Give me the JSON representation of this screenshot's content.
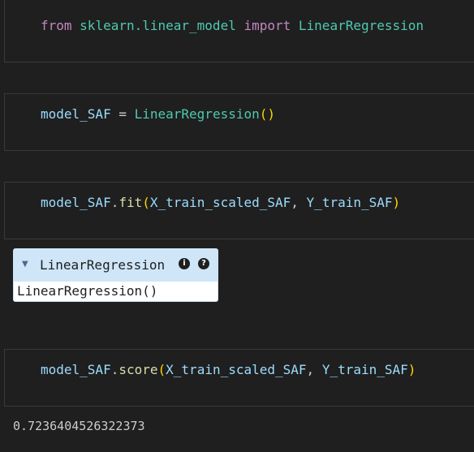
{
  "cells": [
    {
      "tokens": [
        {
          "text": "from",
          "kind": "kw"
        },
        {
          "text": " ",
          "kind": "punc"
        },
        {
          "text": "sklearn.linear_model",
          "kind": "mod"
        },
        {
          "text": " ",
          "kind": "punc"
        },
        {
          "text": "import",
          "kind": "kw"
        },
        {
          "text": " ",
          "kind": "punc"
        },
        {
          "text": "LinearRegression",
          "kind": "cls"
        }
      ]
    },
    {
      "tokens": [
        {
          "text": "model_SAF",
          "kind": "var"
        },
        {
          "text": " = ",
          "kind": "punc"
        },
        {
          "text": "LinearRegression",
          "kind": "cls"
        },
        {
          "text": "()",
          "kind": "paren"
        }
      ]
    },
    {
      "tokens": [
        {
          "text": "model_SAF",
          "kind": "var"
        },
        {
          "text": ".",
          "kind": "punc"
        },
        {
          "text": "fit",
          "kind": "fn"
        },
        {
          "text": "(",
          "kind": "paren"
        },
        {
          "text": "X_train_scaled_SAF",
          "kind": "var"
        },
        {
          "text": ", ",
          "kind": "punc"
        },
        {
          "text": "Y_train_SAF",
          "kind": "var"
        },
        {
          "text": ")",
          "kind": "paren"
        }
      ]
    },
    {
      "tokens": [
        {
          "text": "model_SAF",
          "kind": "var"
        },
        {
          "text": ".",
          "kind": "punc"
        },
        {
          "text": "score",
          "kind": "fn"
        },
        {
          "text": "(",
          "kind": "paren"
        },
        {
          "text": "X_train_scaled_SAF",
          "kind": "var"
        },
        {
          "text": ", ",
          "kind": "punc"
        },
        {
          "text": "Y_train_SAF",
          "kind": "var"
        },
        {
          "text": ")",
          "kind": "paren"
        }
      ]
    }
  ],
  "widget": {
    "title": "LinearRegression",
    "body": "LinearRegression()",
    "info_icon_glyph": "i",
    "help_icon_glyph": "?",
    "arrow_glyph": "▼"
  },
  "output": {
    "score_text": "0.7236404526322373"
  },
  "colors": {
    "background": "#1f1f1f",
    "keyword": "#c586c0",
    "module": "#4ec9b0",
    "variable": "#9cdcfe",
    "function": "#dcdcaa",
    "bracket": "#ffd700",
    "widget_header": "#cfe6f8"
  }
}
